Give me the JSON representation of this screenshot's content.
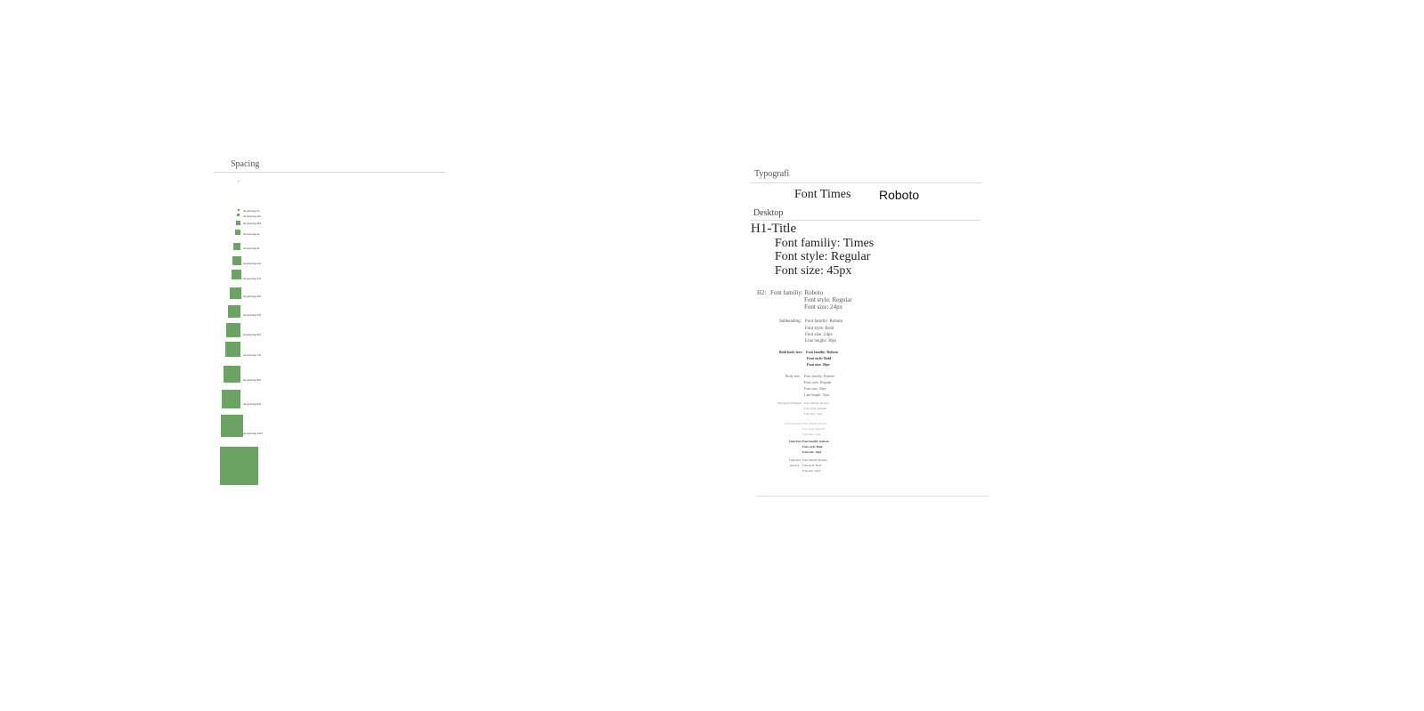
{
  "spacing": {
    "title": "Spacing",
    "dot": "•",
    "items": [
      {
        "label": "ds-spacing-xs"
      },
      {
        "label": "ds-spacing-sm"
      },
      {
        "label": "ds-spacing-md"
      },
      {
        "label": "ds-spacing-lg"
      },
      {
        "label": "ds-spacing-xl"
      },
      {
        "label": "ds-spacing-2xl"
      },
      {
        "label": "ds-spacing-3xl"
      },
      {
        "label": "ds-spacing-4xl"
      },
      {
        "label": "ds-spacing-5xl"
      },
      {
        "label": "ds-spacing-6xl"
      },
      {
        "label": "ds-spacing-7xl"
      },
      {
        "label": "ds-spacing-8xl"
      },
      {
        "label": "ds-spacing-9xl"
      },
      {
        "label": "ds-spacing-10xl"
      },
      {
        "label": ""
      }
    ],
    "color": "#6ba363"
  },
  "typography": {
    "title": "Typografi",
    "font_times": "Font Times",
    "font_roboto": "Roboto",
    "desktop": "Desktop",
    "h1": {
      "title": "H1-Title",
      "family": "Font familiy: Times",
      "style": "Font style: Regular",
      "size": "Font size: 45px"
    },
    "h2": {
      "label": "H2:",
      "family": "Font familiy: Roboto",
      "style": "Font style: Regular",
      "size": "Font size:  24px"
    },
    "subheading": {
      "label": "Subheading:",
      "family": "Font familiy: Roboto",
      "style": "Font style: Bold",
      "size": "Font size:  24px",
      "line": "Line height: 30px"
    },
    "bold_body": {
      "label": "Bold body text:",
      "family": "Font familiy: Roboto",
      "style": "Font style: Bold",
      "size": "Font size: 20px"
    },
    "body": {
      "label": "Body text:",
      "family": "Font familiy: Roboto",
      "style": "Font style: Regular",
      "size": "Font size: 20px",
      "line": "Line height: 32px"
    },
    "images": {
      "label": "Typophones/images:",
      "family": "Font familiy: Roboto",
      "style": "Font style: Regular",
      "size": "Font size: 14px"
    },
    "caption": {
      "label": "Citerat/copies:",
      "family": "Font familiy: Roboto",
      "style": "Font style: Regular",
      "size": "Font size: 14px"
    },
    "link1": {
      "label": "Link Text:",
      "family": "Font familiy: Roboto",
      "style": "Font style: Bold",
      "size": "Font size: 16px"
    },
    "link2": {
      "label": "Link Text:",
      "label2": "(hover):",
      "family": "Font familiy: Roboto",
      "style": "Font style: Bold",
      "size": "Font size: 16px"
    }
  }
}
